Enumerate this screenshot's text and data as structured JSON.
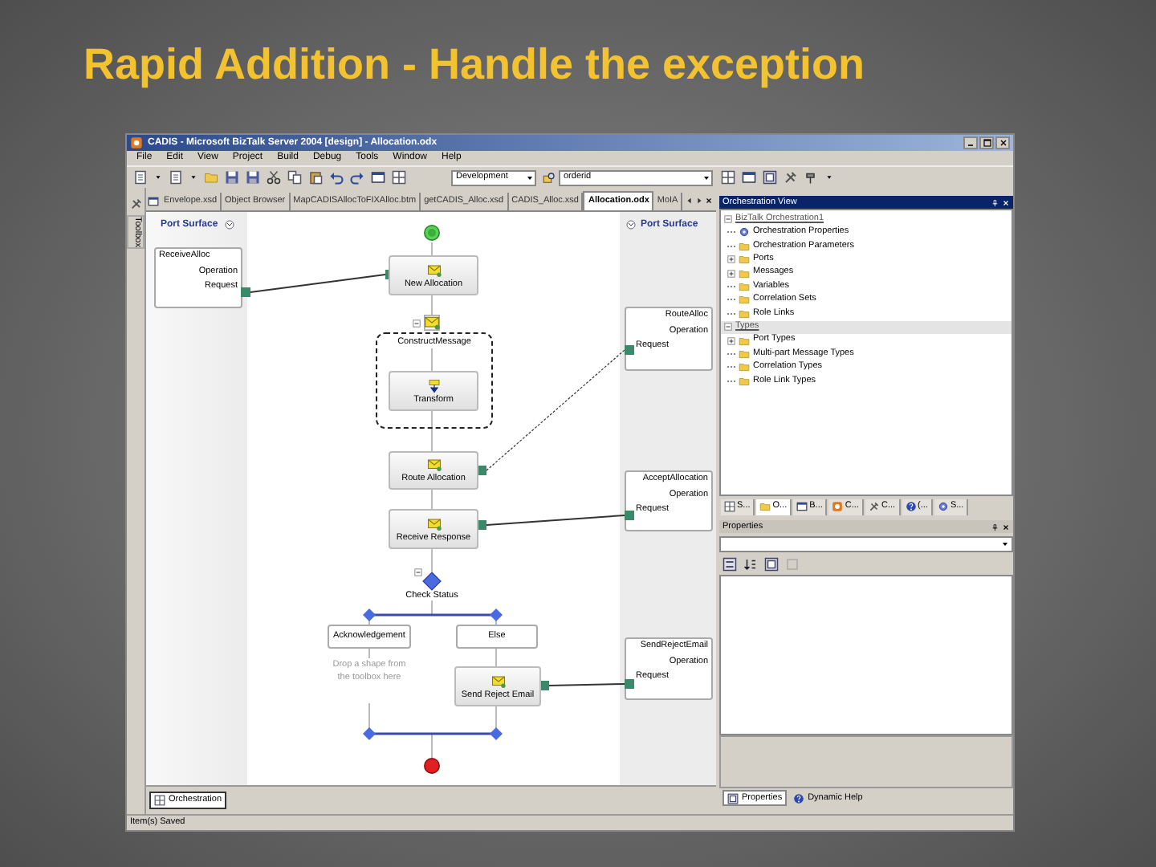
{
  "slide": {
    "title": "Rapid Addition - Handle the exception"
  },
  "window": {
    "title": "CADIS - Microsoft BizTalk Server 2004 [design] - Allocation.odx"
  },
  "menu": [
    "File",
    "Edit",
    "View",
    "Project",
    "Build",
    "Debug",
    "Tools",
    "Window",
    "Help"
  ],
  "toolbar": {
    "configuration": "Development",
    "search": "orderid"
  },
  "toolbox": {
    "label": "Toolbox"
  },
  "document_tabs": [
    {
      "label": "Envelope.xsd",
      "selected": false
    },
    {
      "label": "Object Browser",
      "selected": false
    },
    {
      "label": "MapCADISAllocToFIXAlloc.btm",
      "selected": false
    },
    {
      "label": "getCADIS_Alloc.xsd",
      "selected": false
    },
    {
      "label": "CADIS_Alloc.xsd",
      "selected": false
    },
    {
      "label": "Allocation.odx",
      "selected": true
    },
    {
      "label": "MoIA",
      "selected": false
    }
  ],
  "designer": {
    "port_surfaces": [
      {
        "title": "Port Surface",
        "ports": [
          {
            "name": "ReceiveAlloc",
            "operation": "Operation",
            "message": "Request"
          }
        ]
      },
      {
        "title": "Port Surface",
        "ports": [
          {
            "name": "RouteAlloc",
            "operation": "Operation",
            "message": "Request"
          },
          {
            "name": "AcceptAllocation",
            "operation": "Operation",
            "message": "Request"
          },
          {
            "name": "SendRejectEmail",
            "operation": "Operation",
            "message": "Request"
          }
        ]
      }
    ],
    "shapes": [
      {
        "kind": "start"
      },
      {
        "kind": "receive",
        "label": "New Allocation"
      },
      {
        "kind": "scope",
        "label": "ConstructMessage"
      },
      {
        "kind": "transform",
        "label": "Transform"
      },
      {
        "kind": "send",
        "label": "Route Allocation"
      },
      {
        "kind": "receive",
        "label": "Receive Response"
      },
      {
        "kind": "decide",
        "label": "Check Status"
      },
      {
        "kind": "branch",
        "label": "Acknowledgement"
      },
      {
        "kind": "branch",
        "label": "Else"
      },
      {
        "kind": "hint",
        "label": "Drop a shape from the toolbox here"
      },
      {
        "kind": "send",
        "label": "Send Reject Email"
      },
      {
        "kind": "end"
      }
    ],
    "view_tabs": [
      {
        "label": "Orchestration",
        "selected": true
      }
    ]
  },
  "orchestration_view": {
    "title": "Orchestration View",
    "sections": [
      {
        "label": "BizTalk Orchestration1",
        "expanded": true,
        "items": [
          {
            "kind": "properties",
            "label": "Orchestration Properties",
            "collapsed": false
          },
          {
            "kind": "folder",
            "label": "Orchestration Parameters",
            "collapsed": false
          },
          {
            "kind": "folder",
            "label": "Ports",
            "collapsed": true
          },
          {
            "kind": "folder",
            "label": "Messages",
            "collapsed": true
          },
          {
            "kind": "folder",
            "label": "Variables",
            "collapsed": false
          },
          {
            "kind": "folder",
            "label": "Correlation Sets",
            "collapsed": false
          },
          {
            "kind": "folder",
            "label": "Role Links",
            "collapsed": false
          }
        ]
      },
      {
        "label": "Types",
        "expanded": true,
        "items": [
          {
            "kind": "folder",
            "label": "Port Types",
            "collapsed": true
          },
          {
            "kind": "folder",
            "label": "Multi-part Message Types",
            "collapsed": false
          },
          {
            "kind": "folder",
            "label": "Correlation Types",
            "collapsed": false
          },
          {
            "kind": "folder",
            "label": "Role Link Types",
            "collapsed": false
          }
        ]
      }
    ],
    "tabs": [
      {
        "label": "S...",
        "selected": false
      },
      {
        "label": "O...",
        "selected": true
      },
      {
        "label": "B...",
        "selected": false
      },
      {
        "label": "C...",
        "selected": false
      },
      {
        "label": "C...",
        "selected": false
      },
      {
        "label": "(...",
        "selected": false
      },
      {
        "label": "S...",
        "selected": false
      }
    ]
  },
  "properties": {
    "title": "Properties",
    "tabs": [
      {
        "label": "Properties",
        "selected": true
      },
      {
        "label": "Dynamic Help",
        "selected": false
      }
    ]
  },
  "status_bar": {
    "text": "Item(s) Saved"
  }
}
